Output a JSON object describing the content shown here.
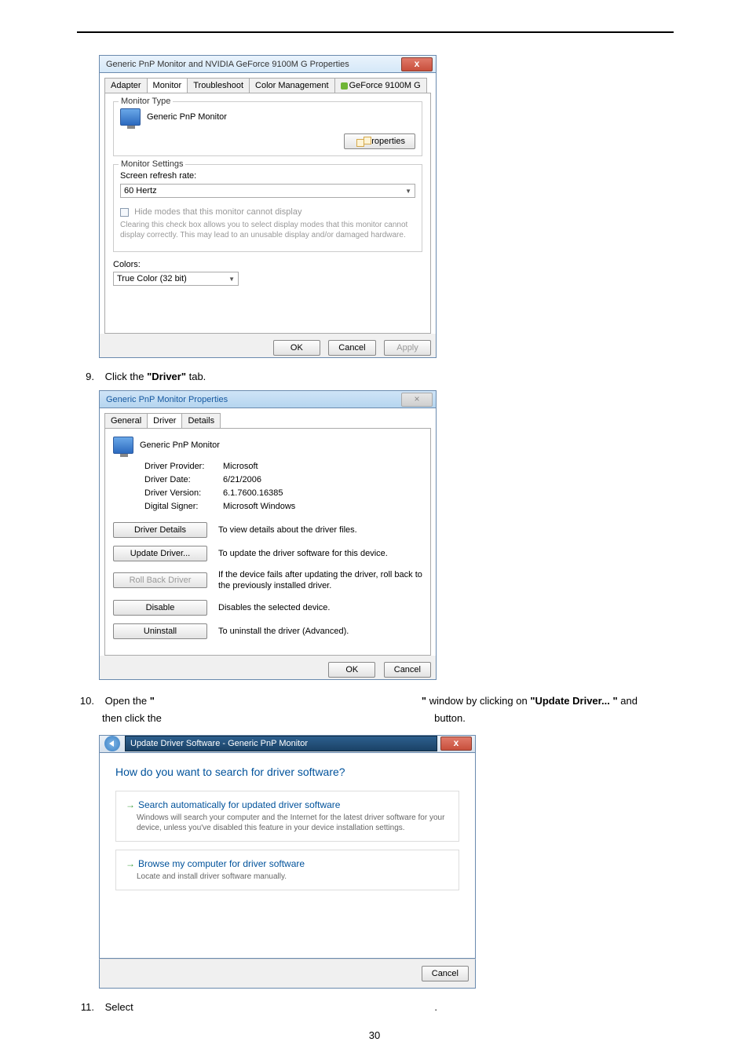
{
  "dlg1": {
    "title": "Generic PnP Monitor and NVIDIA GeForce 9100M G   Properties",
    "tabs": [
      "Adapter",
      "Monitor",
      "Troubleshoot",
      "Color Management",
      "GeForce 9100M G"
    ],
    "grp_monitor_type": "Monitor Type",
    "monitor_name": "Generic PnP Monitor",
    "properties_btn": "Properties",
    "grp_monitor_settings": "Monitor Settings",
    "refresh_label": "Screen refresh rate:",
    "refresh_value": "60 Hertz",
    "hide_modes": "Hide modes that this monitor cannot display",
    "hide_note": "Clearing this check box allows you to select display modes that this monitor cannot display correctly. This may lead to an unusable display and/or damaged hardware.",
    "colors_label": "Colors:",
    "colors_value": "True Color (32 bit)",
    "ok": "OK",
    "cancel": "Cancel",
    "apply": "Apply"
  },
  "step9": {
    "num": "9.",
    "text_before": "Click the ",
    "bold": "\"Driver\"",
    "text_after": " tab."
  },
  "dlg2": {
    "title": "Generic PnP Monitor Properties",
    "tabs": [
      "General",
      "Driver",
      "Details"
    ],
    "monitor_name": "Generic PnP Monitor",
    "provider_l": "Driver Provider:",
    "provider_v": "Microsoft",
    "date_l": "Driver Date:",
    "date_v": "6/21/2006",
    "version_l": "Driver Version:",
    "version_v": "6.1.7600.16385",
    "signer_l": "Digital Signer:",
    "signer_v": "Microsoft Windows",
    "b_details": "Driver Details",
    "d_details": "To view details about the driver files.",
    "b_update": "Update Driver...",
    "d_update": "To update the driver software for this device.",
    "b_rollback": "Roll Back Driver",
    "d_rollback": "If the device fails after updating the driver, roll back to the previously installed driver.",
    "b_disable": "Disable",
    "d_disable": "Disables the selected device.",
    "b_uninstall": "Uninstall",
    "d_uninstall": "To uninstall the driver (Advanced).",
    "ok": "OK",
    "cancel": "Cancel"
  },
  "step10": {
    "num": "10.",
    "t1": "Open the ",
    "b1": "\"",
    "t2": "",
    "b2": "\"",
    "t3": " window by clicking on ",
    "b3": "\"Update Driver... \"",
    "t4": " and",
    "line2_a": "then click the ",
    "line2_b": "",
    "line2_c": " button."
  },
  "dlg3": {
    "inner_title": "Update Driver Software - Generic PnP Monitor",
    "question": "How do you want to search for driver software?",
    "opt1_title": "Search automatically for updated driver software",
    "opt1_desc": "Windows will search your computer and the Internet for the latest driver software for your device, unless you've disabled this feature in your device installation settings.",
    "opt2_title": "Browse my computer for driver software",
    "opt2_desc": "Locate and install driver software manually.",
    "cancel": "Cancel"
  },
  "step11": {
    "num": "11.",
    "text": "Select ",
    "dot": "."
  },
  "page_num": "30"
}
